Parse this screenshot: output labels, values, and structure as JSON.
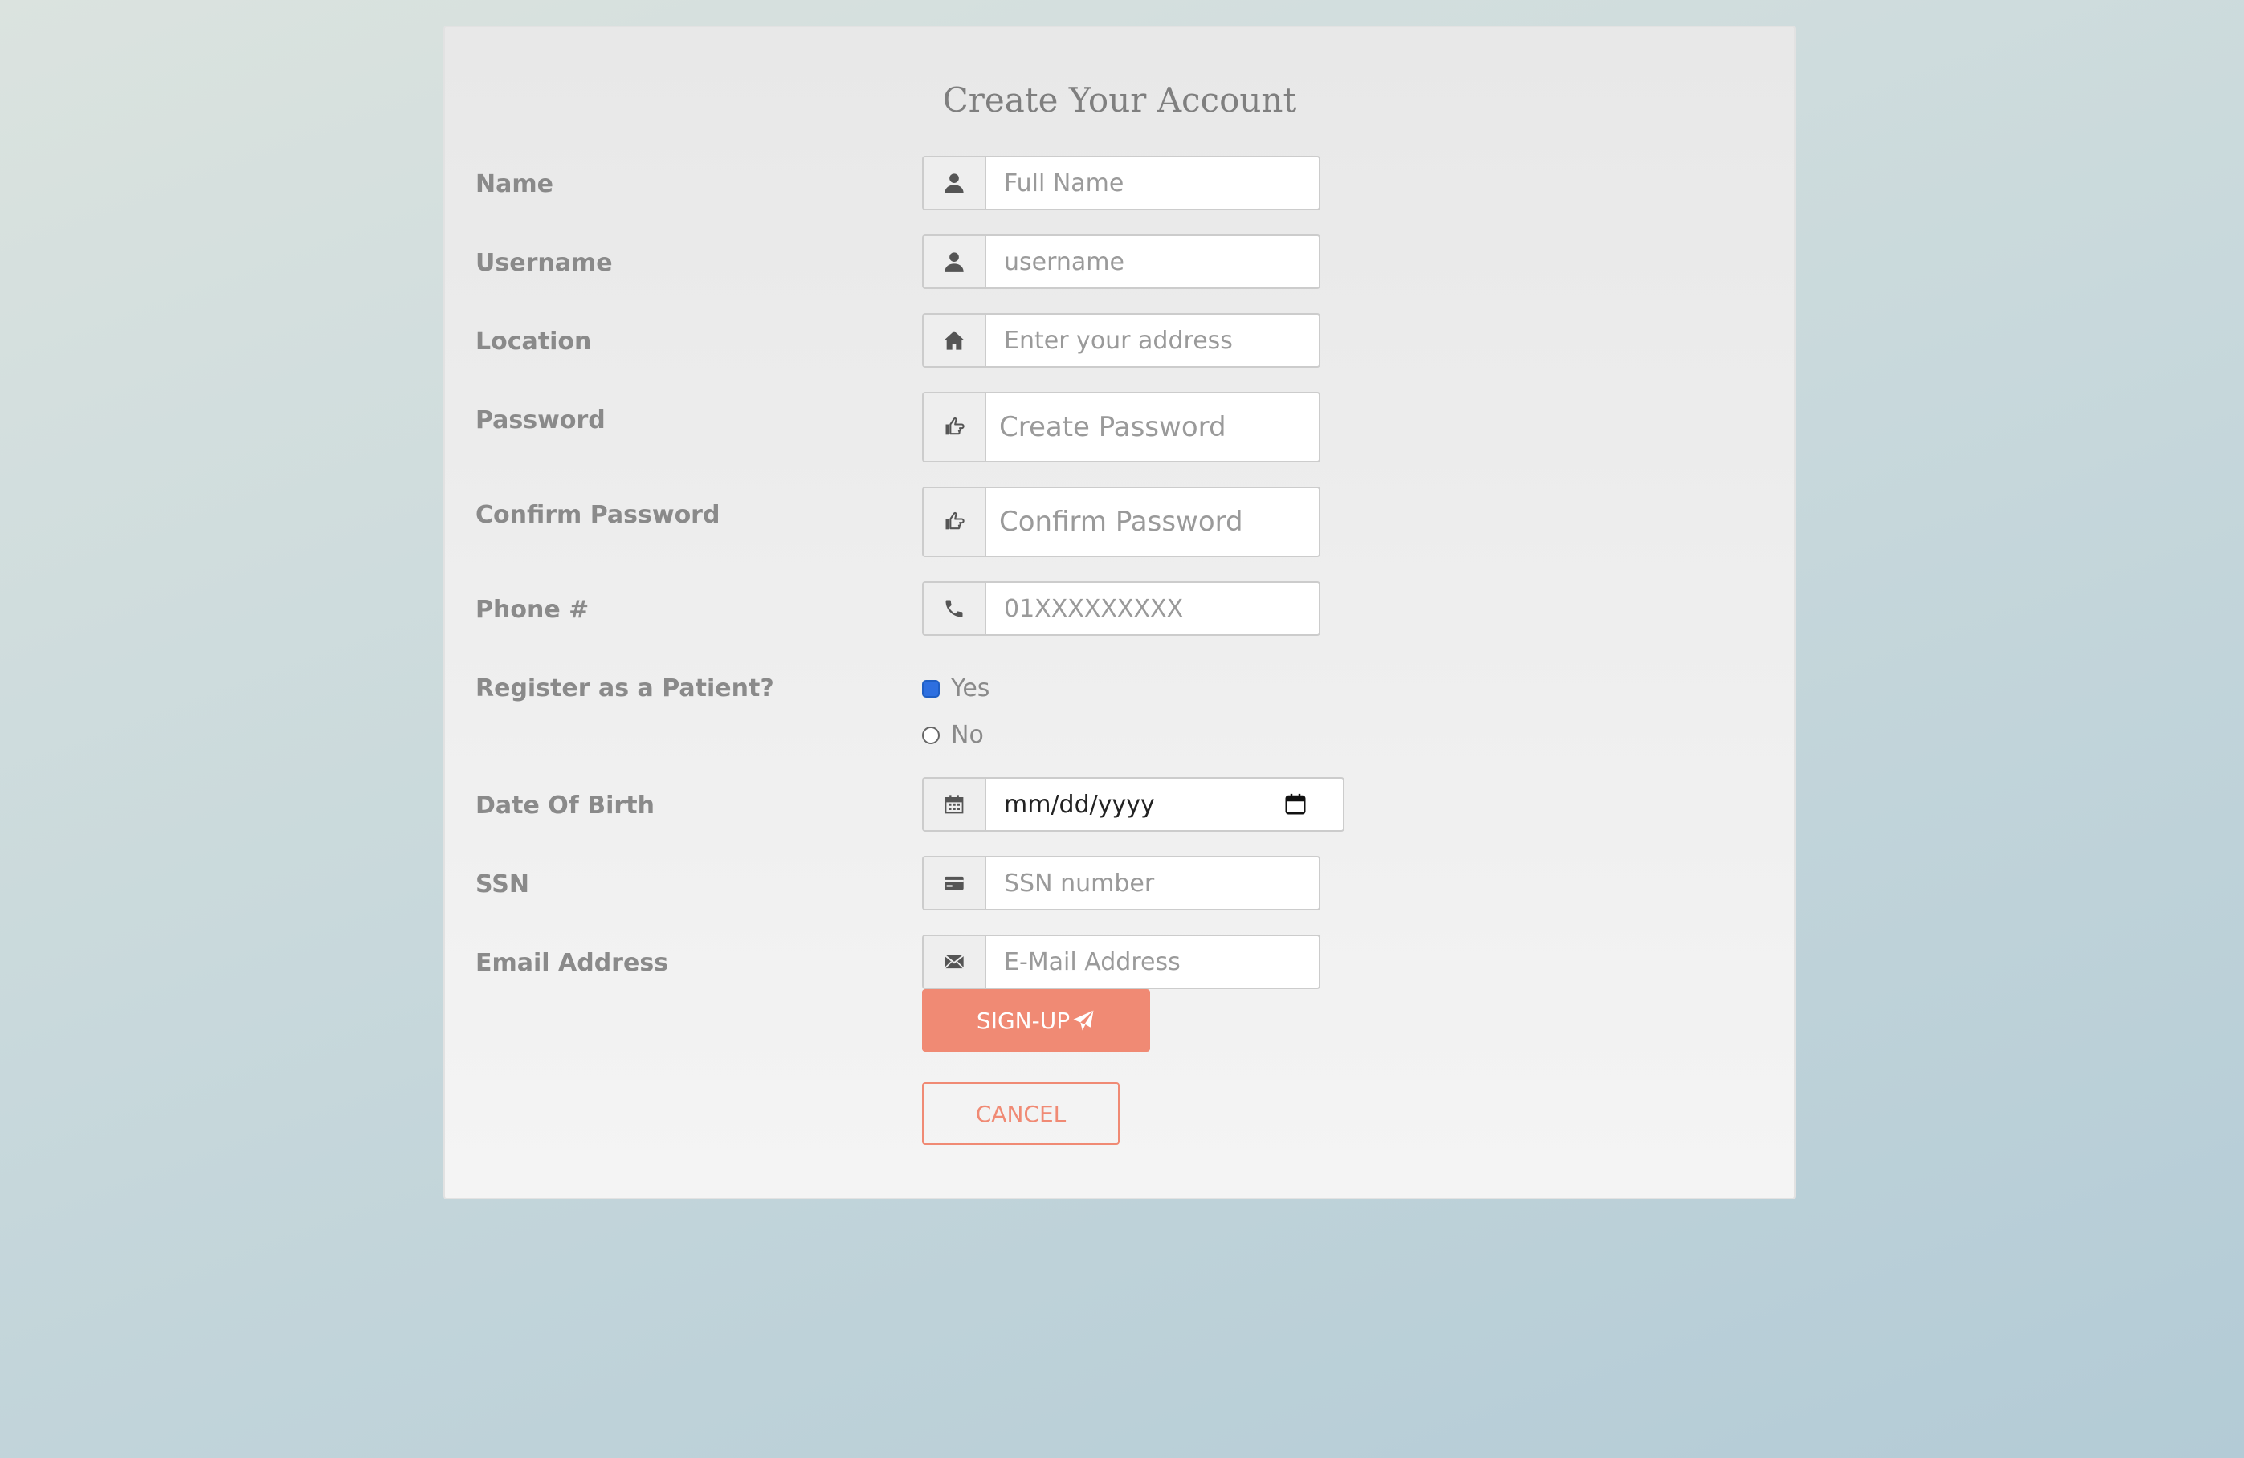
{
  "form": {
    "title": "Create Your Account",
    "fields": {
      "name": {
        "label": "Name",
        "placeholder": "Full Name",
        "icon": "user-icon"
      },
      "username": {
        "label": "Username",
        "placeholder": "username",
        "icon": "user-icon"
      },
      "location": {
        "label": "Location",
        "placeholder": "Enter your address",
        "icon": "home-icon"
      },
      "password": {
        "label": "Password",
        "placeholder": "Create Password",
        "icon": "hand-pointing-icon"
      },
      "confirm_password": {
        "label": "Confirm Password",
        "placeholder": "Confirm Password",
        "icon": "hand-pointing-icon"
      },
      "phone": {
        "label": "Phone #",
        "placeholder": "01XXXXXXXXX",
        "icon": "phone-icon"
      },
      "dob": {
        "label": "Date Of Birth",
        "value": "mm/dd/yyyy",
        "icon": "calendar-icon"
      },
      "ssn": {
        "label": "SSN",
        "placeholder": "SSN number",
        "icon": "credit-card-icon"
      },
      "email": {
        "label": "Email Address",
        "placeholder": "E-Mail Address",
        "icon": "envelope-icon"
      }
    },
    "patient": {
      "label": "Register as a Patient?",
      "options": [
        {
          "label": "Yes",
          "selected": true
        },
        {
          "label": "No",
          "selected": false
        }
      ]
    },
    "buttons": {
      "signup": "SIGN-UP",
      "cancel": "CANCEL"
    }
  },
  "colors": {
    "accent": "#f08a74",
    "label": "#8a8a8a",
    "radio_selected": "#2d6fe0"
  }
}
